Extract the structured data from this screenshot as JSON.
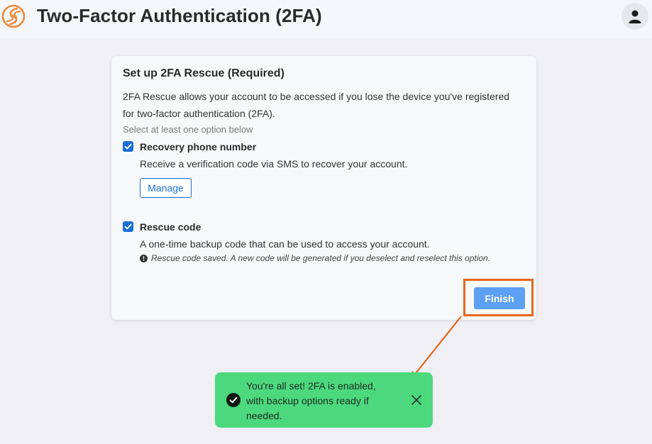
{
  "header": {
    "title": "Two-Factor Authentication (2FA)",
    "logo_icon": "s-swirl-logo",
    "profile_icon": "user-icon"
  },
  "card": {
    "title": "Set up 2FA Rescue (Required)",
    "description": "2FA Rescue allows your account to be accessed if you lose the device you've registered for two-factor authentication (2FA).",
    "hint": "Select at least one option below",
    "options": [
      {
        "label": "Recovery phone number",
        "description": "Receive a verification code via SMS to recover your account.",
        "checked": true,
        "button": "Manage"
      },
      {
        "label": "Rescue code",
        "description": "A one-time backup code that can be used to access your account.",
        "checked": true,
        "note": "Rescue code saved. A new code will be generated if you deselect and reselect this option."
      }
    ],
    "finish_label": "Finish"
  },
  "toast": {
    "message": "You're all set! 2FA is enabled, with backup options ready if needed.",
    "status_icon": "check-circle-icon",
    "close_icon": "close-icon"
  },
  "colors": {
    "accent": "#1a6fd4",
    "finish_button": "#5ba0f3",
    "toast_bg": "#4cd97e",
    "highlight": "#e8661e",
    "logo": "#f08a3c"
  }
}
